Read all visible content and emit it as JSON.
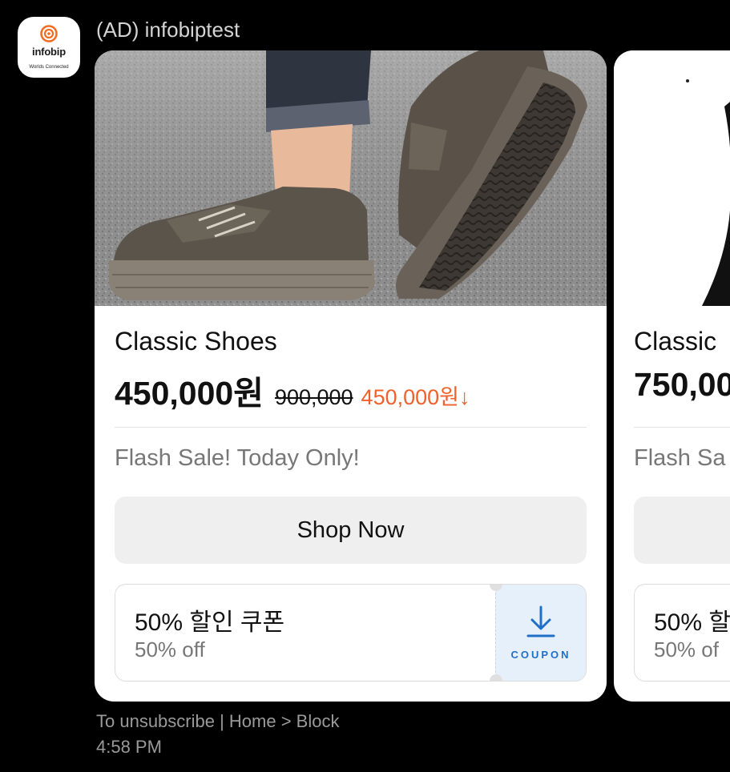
{
  "sender": {
    "brand_name": "infobip",
    "brand_tagline": "Worlds Connected",
    "display_name": "(AD) infobiptest"
  },
  "cards": [
    {
      "title": "Classic Shoes",
      "price": "450,000원",
      "original_price": "900,000",
      "discount": "450,000원↓",
      "description": "Flash Sale! Today Only!",
      "button_label": "Shop Now",
      "coupon": {
        "title": "50% 할인 쿠폰",
        "subtitle": "50% off",
        "action_label": "COUPON"
      }
    },
    {
      "title": "Classic",
      "price": "750,00",
      "description": "Flash Sa",
      "coupon": {
        "title": "50% 할",
        "subtitle": "50% of"
      }
    }
  ],
  "footer": {
    "links": "To unsubscribe | Home > Block",
    "time": "4:58 PM"
  },
  "colors": {
    "background": "#000000",
    "card": "#ffffff",
    "discount": "#f0602b",
    "coupon_accent": "#1f6fc9",
    "coupon_bg": "#e6f0fb",
    "brand_orange": "#f26b21"
  },
  "icons": {
    "brand": "infobip-ring-icon",
    "coupon_action": "download-icon"
  }
}
